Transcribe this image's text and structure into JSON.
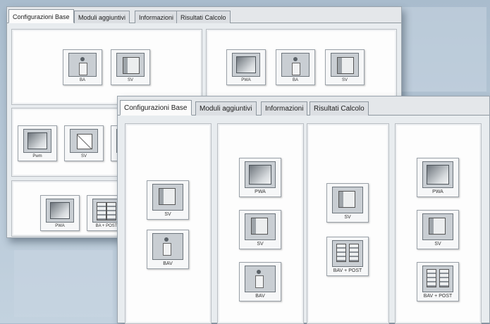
{
  "tabs": [
    "Configurazioni Base",
    "Moduli aggiuntivi",
    "Informazioni",
    "Risultati Calcolo"
  ],
  "back_window": {
    "panel1": [
      {
        "label": "BA",
        "face": "button"
      },
      {
        "label": "SV",
        "face": "speaker"
      }
    ],
    "panel2": [
      {
        "label": "PWA",
        "face": "screen"
      },
      {
        "label": "BA",
        "face": "button"
      },
      {
        "label": "SV",
        "face": "speaker"
      }
    ],
    "panel3": [
      {
        "label": "Pwm",
        "face": "screen"
      },
      {
        "label": "SV",
        "face": "tiny"
      },
      {
        "label": "",
        "face": "screen"
      }
    ],
    "panel5": [
      {
        "label": "PWA",
        "face": "screen"
      },
      {
        "label": "BA + POST",
        "face": "double"
      }
    ]
  },
  "front_window": {
    "columns": [
      [
        {
          "label": "SV",
          "face": "speaker"
        },
        {
          "label": "BAV",
          "face": "button"
        }
      ],
      [
        {
          "label": "PWA",
          "face": "screen"
        },
        {
          "label": "SV",
          "face": "speaker"
        },
        {
          "label": "BAV",
          "face": "button"
        }
      ],
      [
        {
          "label": "SV",
          "face": "speaker"
        },
        {
          "label": "BAV + POST",
          "face": "double"
        }
      ],
      [
        {
          "label": "PWA",
          "face": "screen"
        },
        {
          "label": "SV",
          "face": "speaker"
        },
        {
          "label": "BAV + POST",
          "face": "double"
        }
      ]
    ]
  }
}
